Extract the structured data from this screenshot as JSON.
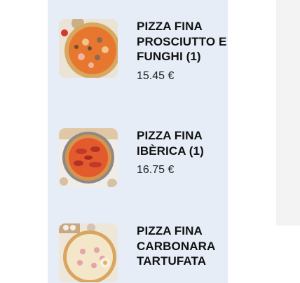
{
  "menu": {
    "items": [
      {
        "name": "PIZZA FINA PROSCIUTTO E FUNGHI (1)",
        "price": "15.45 €",
        "image_icon": "pizza-prosciutto-funghi-image"
      },
      {
        "name": "PIZZA FINA IBÈRICA (1)",
        "price": "16.75 €",
        "image_icon": "pizza-iberica-image"
      },
      {
        "name": "PIZZA FINA CARBONARA TARTUFATA",
        "price": "",
        "image_icon": "pizza-carbonara-tartufata-image"
      }
    ]
  },
  "colors": {
    "panel_background": "#e6edf7",
    "text_primary": "#111111",
    "right_panel_background": "#f3f3f3"
  }
}
